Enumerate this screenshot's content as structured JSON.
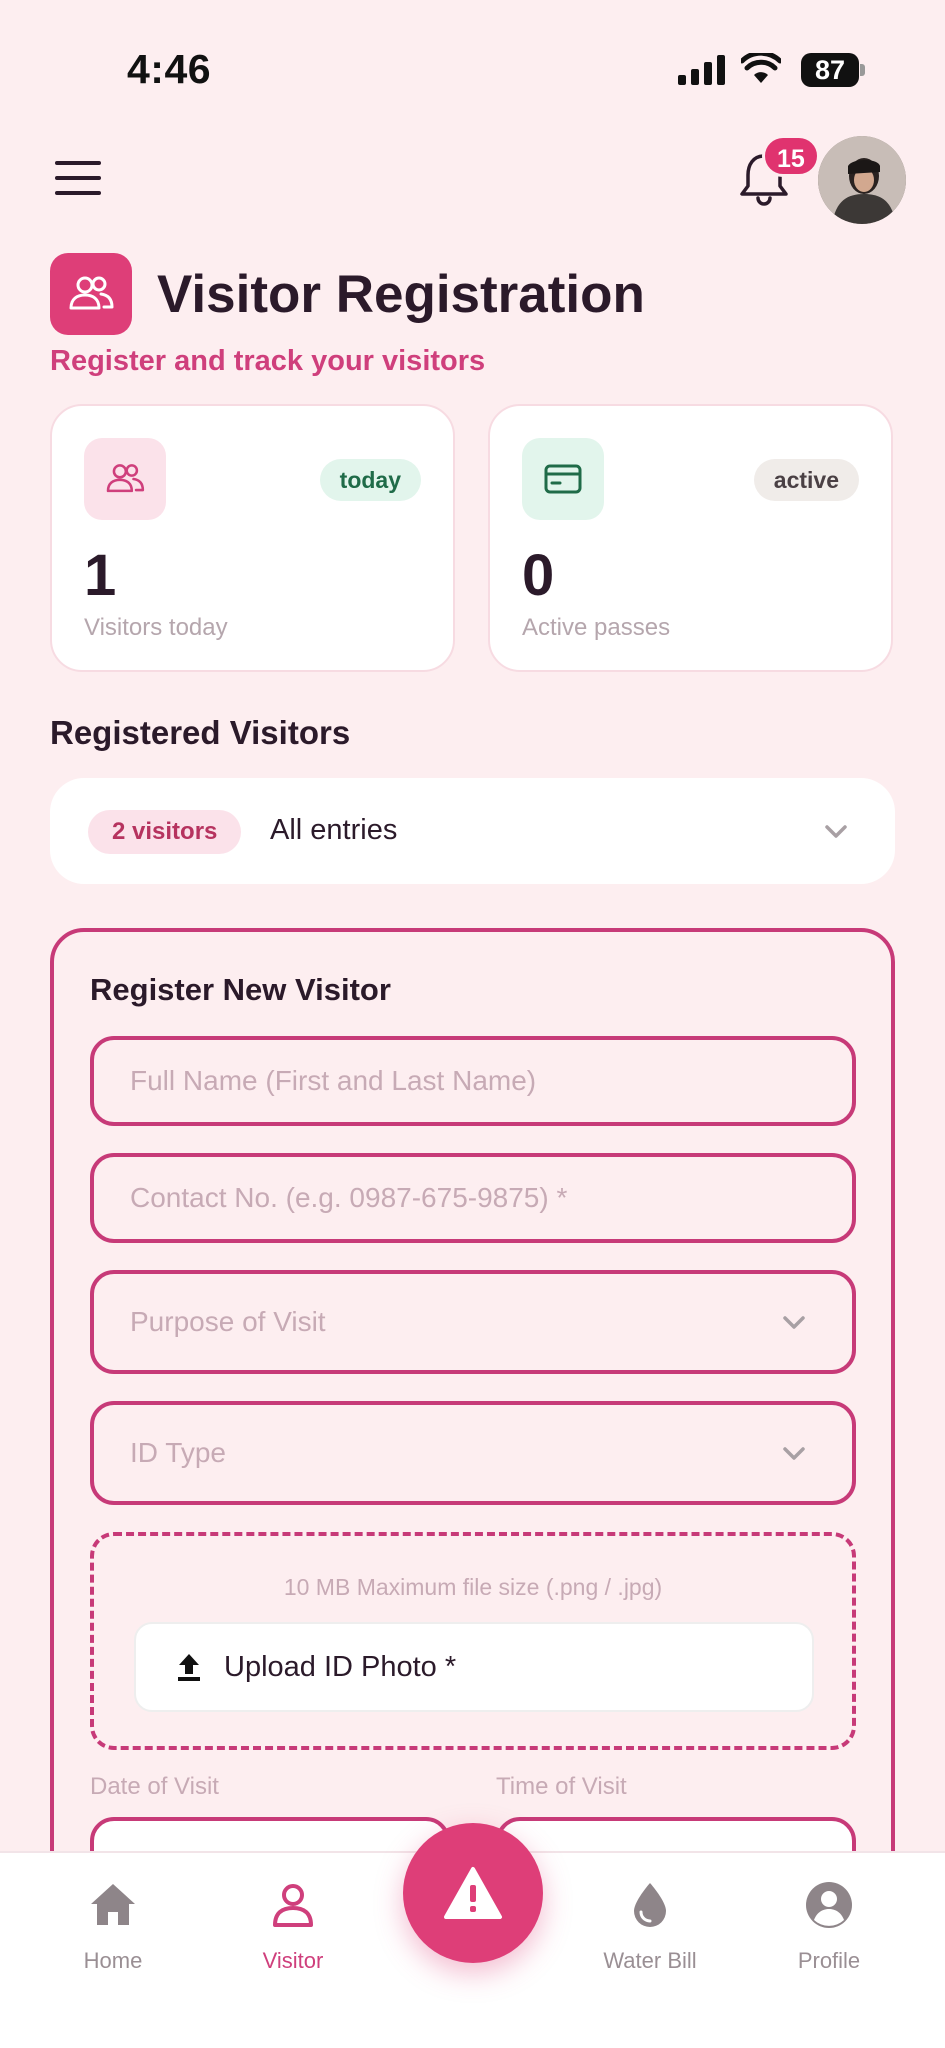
{
  "status_bar": {
    "time": "4:46",
    "battery": "87"
  },
  "header": {
    "notification_count": "15"
  },
  "page": {
    "title": "Visitor Registration",
    "subtitle": "Register and track your visitors"
  },
  "stats": [
    {
      "pill": "today",
      "value": "1",
      "label": "Visitors today",
      "icon": "users-icon",
      "pill_bg": "#e2f5ec",
      "pill_color": "#1f6b48",
      "icon_bg": "#fbe2ea"
    },
    {
      "pill": "active",
      "value": "0",
      "label": "Active passes",
      "icon": "id-card-icon",
      "pill_bg": "#f0ece9",
      "pill_color": "#4a4044",
      "icon_bg": "#e2f5ec"
    }
  ],
  "registered": {
    "title": "Registered Visitors",
    "count_pill": "2 visitors",
    "filter_value": "All entries"
  },
  "form": {
    "title": "Register New Visitor",
    "full_name_placeholder": "Full Name (First and Last Name)",
    "contact_placeholder": "Contact No. (e.g. 0987-675-9875) *",
    "purpose_placeholder": "Purpose of Visit",
    "id_type_placeholder": "ID Type",
    "upload_hint": "10 MB Maximum file size (.png / .jpg)",
    "upload_label": "Upload ID Photo *",
    "date_label": "Date of Visit",
    "time_label": "Time of Visit"
  },
  "nav": {
    "home": "Home",
    "visitor": "Visitor",
    "water_bill": "Water Bill",
    "profile": "Profile"
  },
  "colors": {
    "accent": "#de3e78",
    "background": "#fdeef0",
    "border": "#c73a78"
  }
}
